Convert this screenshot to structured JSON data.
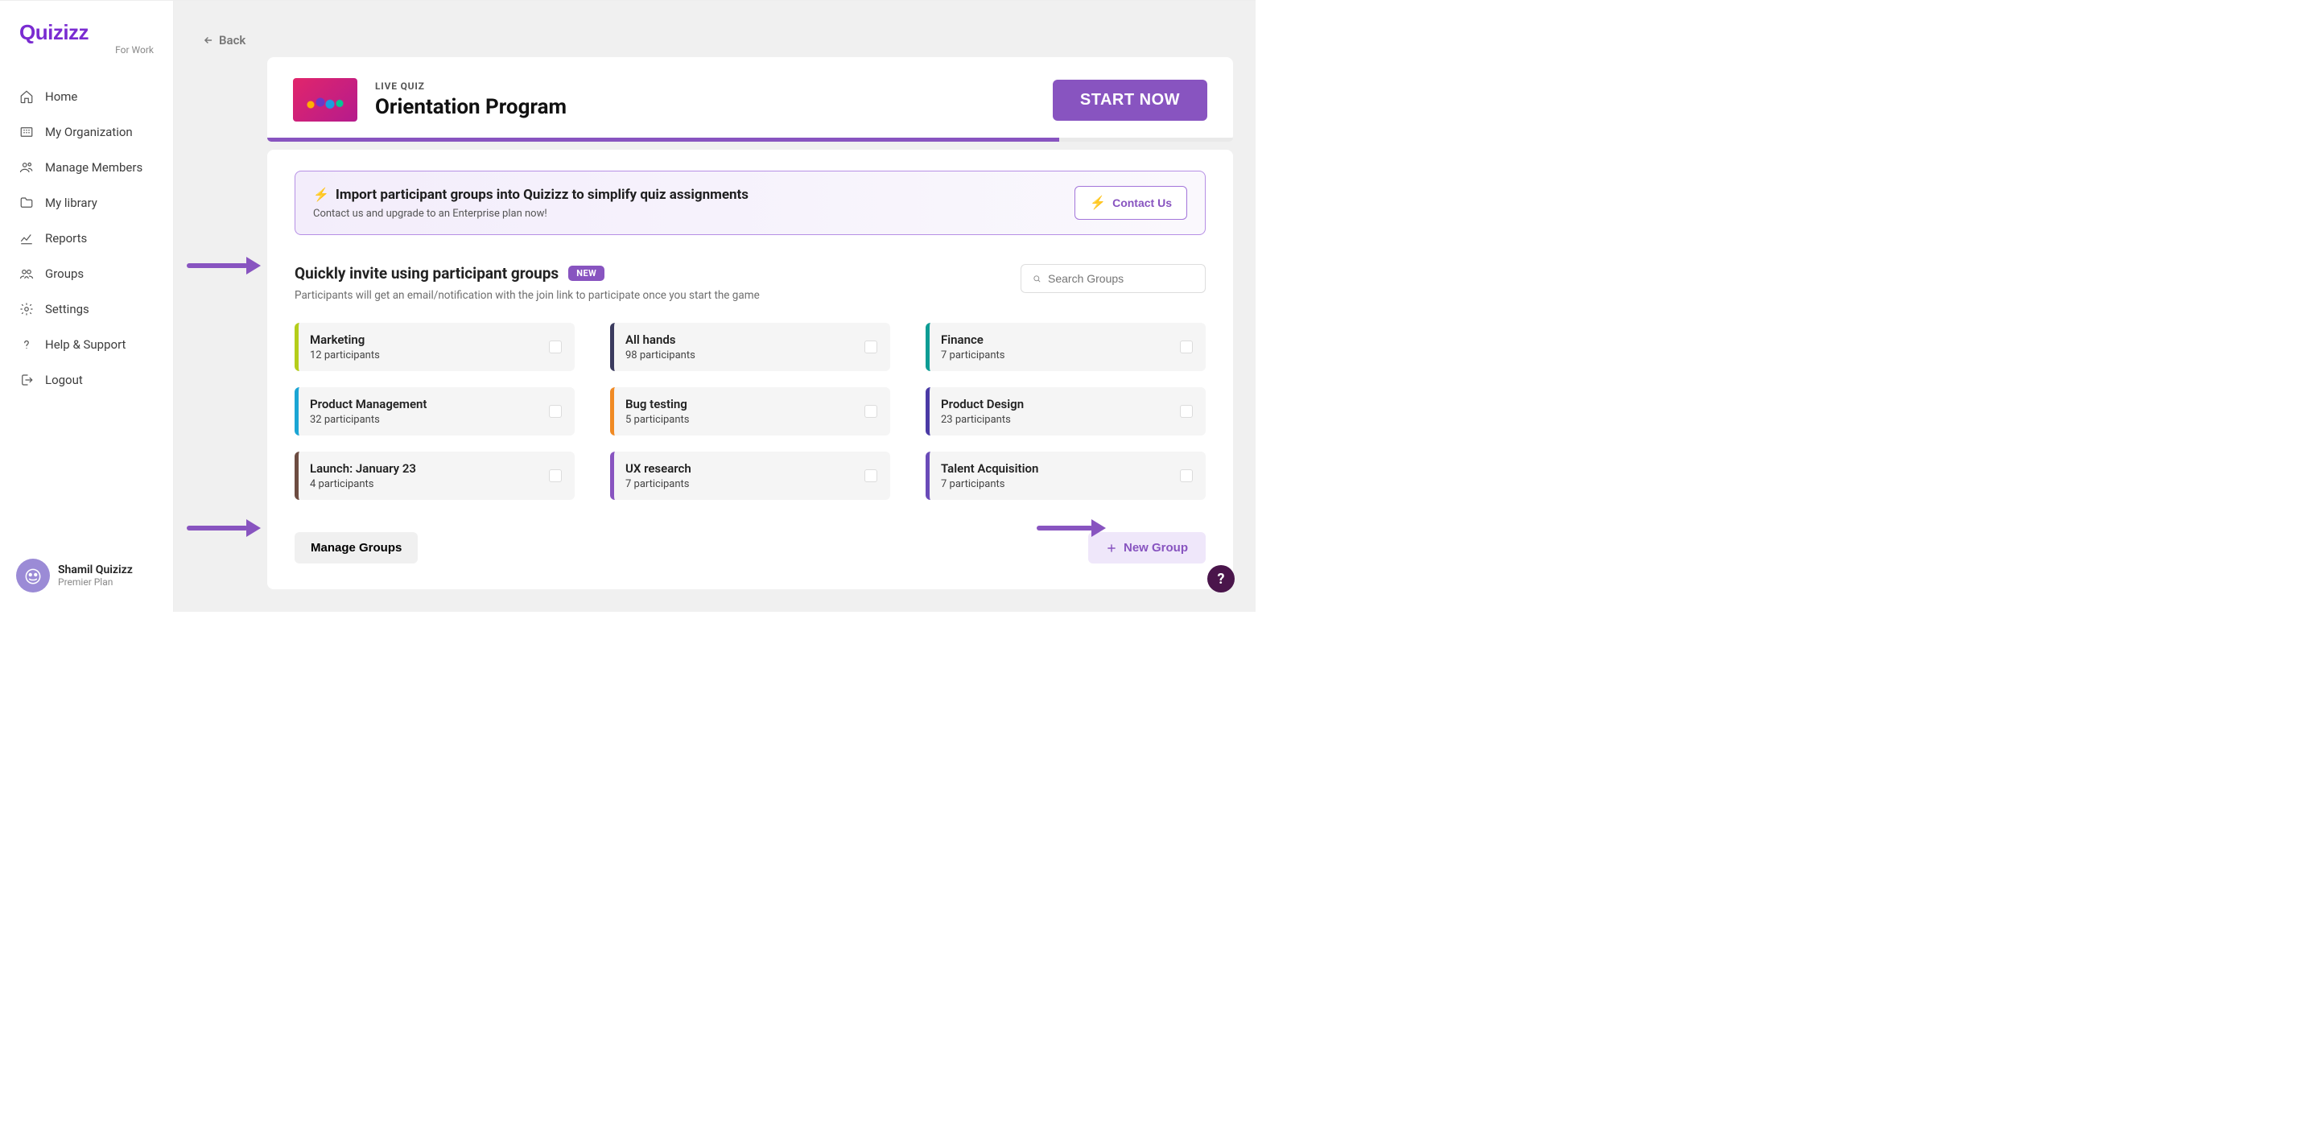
{
  "logo": {
    "text": "Quizizz",
    "subtext": "For Work"
  },
  "nav": [
    {
      "label": "Home"
    },
    {
      "label": "My Organization"
    },
    {
      "label": "Manage Members"
    },
    {
      "label": "My library"
    },
    {
      "label": "Reports"
    },
    {
      "label": "Groups"
    },
    {
      "label": "Settings"
    },
    {
      "label": "Help & Support"
    },
    {
      "label": "Logout"
    }
  ],
  "user": {
    "name": "Shamil Quizizz",
    "plan": "Premier Plan"
  },
  "back_label": "Back",
  "quiz": {
    "label": "LIVE QUIZ",
    "title": "Orientation Program",
    "start_label": "START NOW"
  },
  "banner": {
    "title": "Import participant groups into Quizizz to simplify quiz assignments",
    "subtitle": "Contact us and upgrade to an Enterprise plan now!",
    "cta": "Contact Us"
  },
  "section": {
    "title": "Quickly invite using participant groups",
    "badge": "NEW",
    "subtitle": "Participants will get an email/notification with the join link to participate once you start the game"
  },
  "search": {
    "placeholder": "Search Groups"
  },
  "groups": [
    {
      "name": "Marketing",
      "count": "12 participants",
      "color": "#b4cd1b"
    },
    {
      "name": "All hands",
      "count": "98 participants",
      "color": "#3a3a5e"
    },
    {
      "name": "Finance",
      "count": "7 participants",
      "color": "#0d9c94"
    },
    {
      "name": "Product Management",
      "count": "32 participants",
      "color": "#1ba5d4"
    },
    {
      "name": "Bug testing",
      "count": "5 participants",
      "color": "#f08a24"
    },
    {
      "name": "Product Design",
      "count": "23 participants",
      "color": "#4a3aa5"
    },
    {
      "name": "Launch: January 23",
      "count": "4 participants",
      "color": "#6d4c41"
    },
    {
      "name": "UX research",
      "count": "7 participants",
      "color": "#8854C0"
    },
    {
      "name": "Talent Acquisition",
      "count": "7 participants",
      "color": "#6a4bb8"
    }
  ],
  "footer": {
    "manage_label": "Manage Groups",
    "new_group_label": "New Group"
  },
  "help": "?"
}
